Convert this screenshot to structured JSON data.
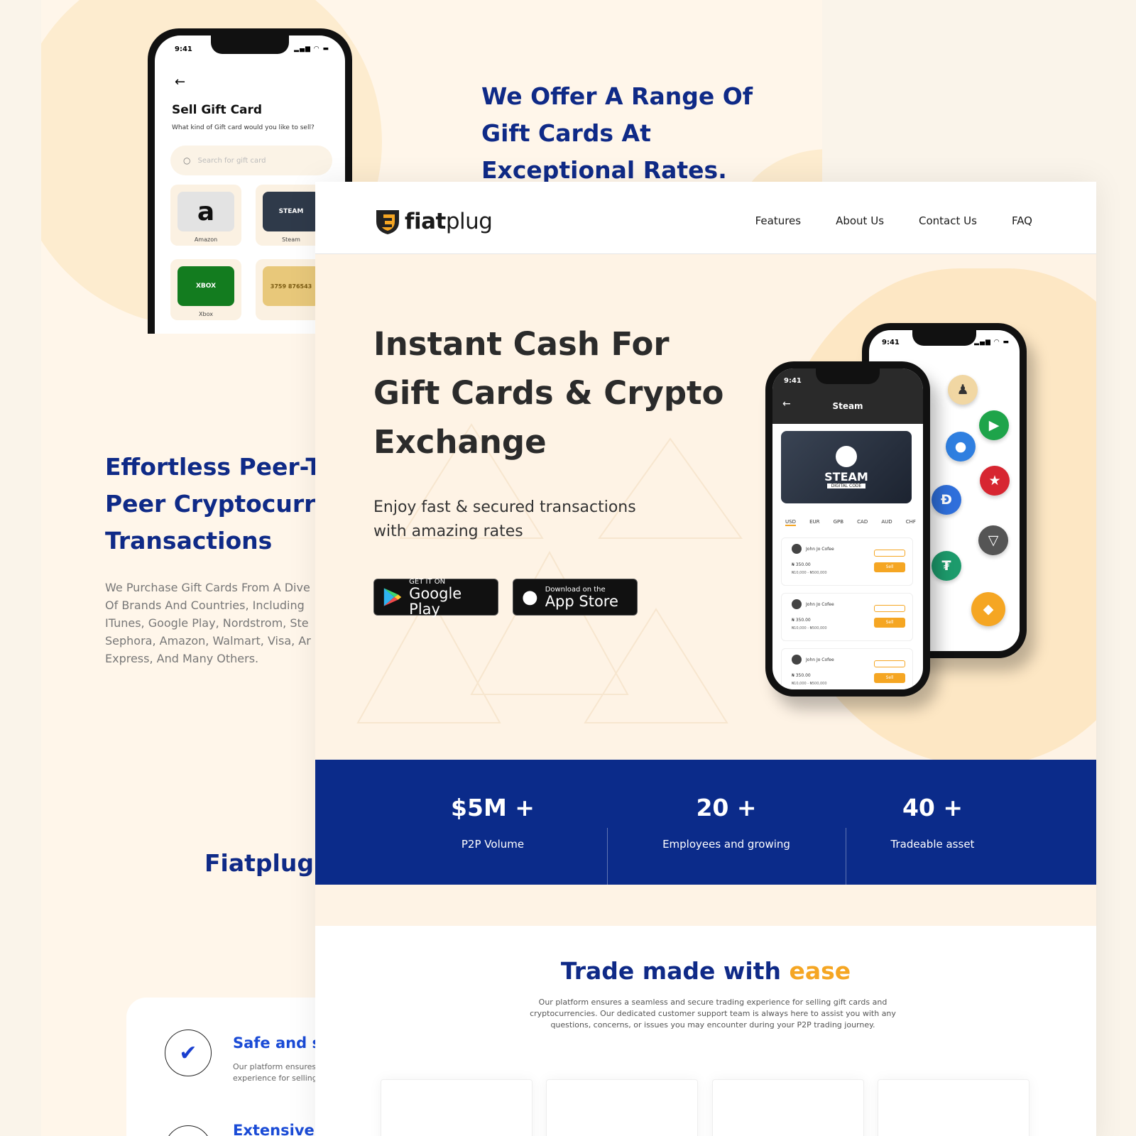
{
  "back": {
    "offer_title": [
      "We Offer A Range Of",
      "Gift Cards At",
      "Exceptional Rates."
    ],
    "p2p_title": [
      "Effortless Peer-To",
      "Peer Cryptocurre",
      "Transactions"
    ],
    "p2p_text": [
      "We Purchase Gift Cards From A Dive",
      "Of Brands And Countries, Including",
      "ITunes, Google Play, Nordstrom, Ste",
      "Sephora, Amazon, Walmart, Visa, Ar",
      "Express, And Many Others."
    ],
    "fiatplug_heading": "Fiatplug",
    "features": [
      {
        "title": "Safe and se",
        "text": [
          "Our platform ensures",
          "experience for selling"
        ]
      },
      {
        "title": "Extensive G",
        "text": []
      }
    ],
    "phone": {
      "time": "9:41",
      "title": "Sell Gift Card",
      "subtitle": "What kind of Gift card would you like to sell?",
      "search_placeholder": "Search for gift card",
      "cards": [
        {
          "label": "Amazon",
          "color": "#e6e6e6",
          "glyph": "a"
        },
        {
          "label": "Steam",
          "color": "#2f3a4a",
          "glyph": "STEAM"
        },
        {
          "label": "Xbox",
          "color": "#137c1f",
          "glyph": "XBOX"
        },
        {
          "label": "",
          "color": "#e8c87a",
          "glyph": "3759 876543"
        }
      ]
    }
  },
  "nav": {
    "logo": {
      "bold": "fiat",
      "light": "plug"
    },
    "links": [
      "Features",
      "About Us",
      "Contact Us",
      "FAQ"
    ]
  },
  "hero": {
    "title": "Instant Cash For Gift Cards & Crypto Exchange",
    "subtitle": "Enjoy fast & secured transactions with amazing rates",
    "google": {
      "small": "GET IT ON",
      "big": "Google Play"
    },
    "apple": {
      "small": "Download on the",
      "big": "App Store"
    },
    "phone_front": {
      "time": "9:41",
      "title": "Steam",
      "card_brand": "STEAM",
      "card_sub": "DIGITAL CODE",
      "currencies": [
        "USD",
        "EUR",
        "GPB",
        "CAD",
        "AUD",
        "CHF"
      ],
      "rows": [
        {
          "name": "John Jo Cofee",
          "amount": "₦ 350.00",
          "limit": "₦10,000 - ₦500,000",
          "sell": "Sell"
        },
        {
          "name": "John Jo Cofee",
          "amount": "₦ 350.00",
          "limit": "₦10,000 - ₦500,000",
          "sell": "Sell"
        },
        {
          "name": "John Jo Cofee",
          "amount": "₦ 350.00",
          "limit": "₦10,000 - ₦500,000",
          "sell": "Sell"
        }
      ]
    },
    "phone_back_time": "9:41",
    "coins": [
      {
        "name": "playstation",
        "color": "#f1d7a3",
        "glyph": "♟"
      },
      {
        "name": "google-play",
        "color": "#1ea44a",
        "glyph": "▶"
      },
      {
        "name": "apple",
        "color": "#2f7fe0",
        "glyph": "●"
      },
      {
        "name": "macys",
        "color": "#d72631",
        "glyph": "★"
      },
      {
        "name": "dai",
        "color": "#2f6fdb",
        "glyph": "Đ"
      },
      {
        "name": "tron",
        "color": "#555",
        "glyph": "▽"
      },
      {
        "name": "tether",
        "color": "#1d9b6c",
        "glyph": "₮"
      },
      {
        "name": "binance",
        "color": "#f5a623",
        "glyph": "◆"
      }
    ]
  },
  "stats": [
    {
      "value": "$5M +",
      "label": "P2P Volume"
    },
    {
      "value": "20 +",
      "label": "Employees and growing"
    },
    {
      "value": "40 +",
      "label": "Tradeable asset"
    }
  ],
  "trade": {
    "title_main": "Trade made with ",
    "title_accent": "ease",
    "text": "Our platform ensures a seamless and secure trading experience for selling gift cards and cryptocurrencies. Our dedicated customer support team is always here to assist you with any questions, concerns, or issues you may encounter during your P2P trading journey."
  },
  "colors": {
    "navy": "#0b2b8a",
    "accent": "#f5a623",
    "cream": "#fef3e5"
  }
}
